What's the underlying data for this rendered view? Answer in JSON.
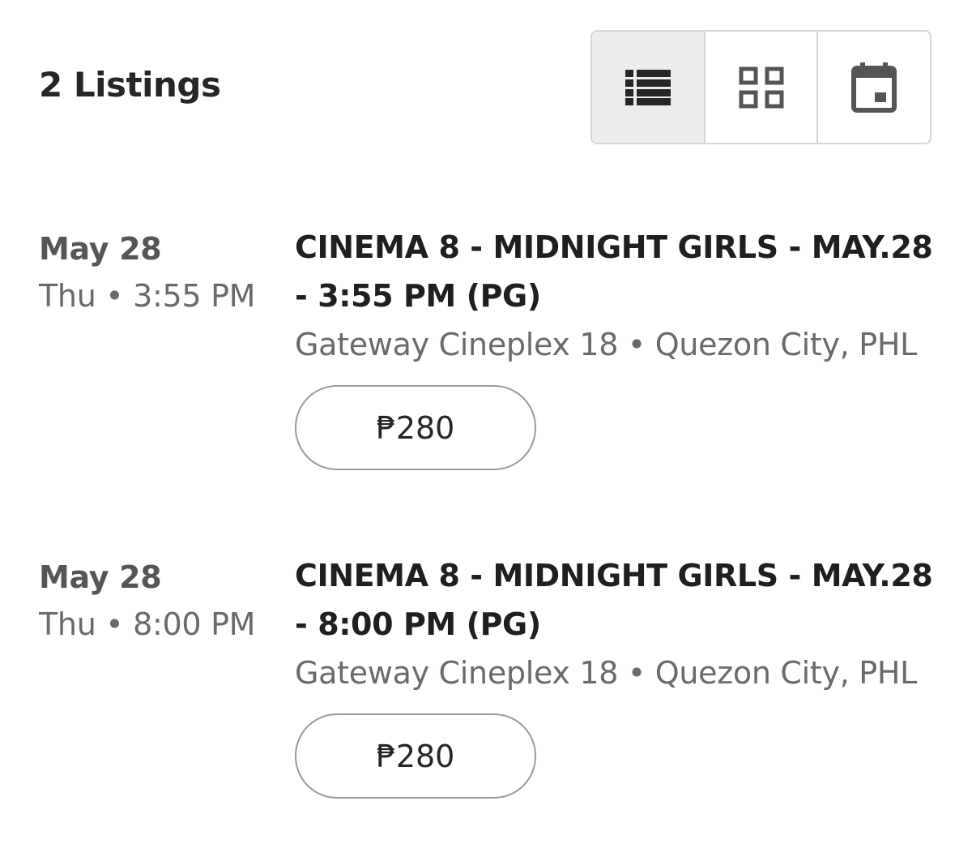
{
  "header": {
    "listing_count": "2 Listings",
    "views": [
      {
        "name": "list-view",
        "icon": "list-icon",
        "active": true
      },
      {
        "name": "grid-view",
        "icon": "grid-icon",
        "active": false
      },
      {
        "name": "calendar-view",
        "icon": "calendar-icon",
        "active": false
      }
    ]
  },
  "listings": [
    {
      "date": "May 28",
      "time": "Thu • 3:55 PM",
      "title": "CINEMA 8 - MIDNIGHT GIRLS - MAY.28 - 3:55 PM (PG)",
      "venue": "Gateway Cineplex 18 • Quezon City, PHL",
      "price": "₱280"
    },
    {
      "date": "May 28",
      "time": "Thu • 8:00 PM",
      "title": "CINEMA 8 - MIDNIGHT GIRLS - MAY.28 - 8:00 PM (PG)",
      "venue": "Gateway Cineplex 18 • Quezon City, PHL",
      "price": "₱280"
    }
  ],
  "colors": {
    "active_view_bg": "#ececec",
    "border": "#d6d6d6",
    "icon": "#262626",
    "icon_inactive": "#555555"
  }
}
